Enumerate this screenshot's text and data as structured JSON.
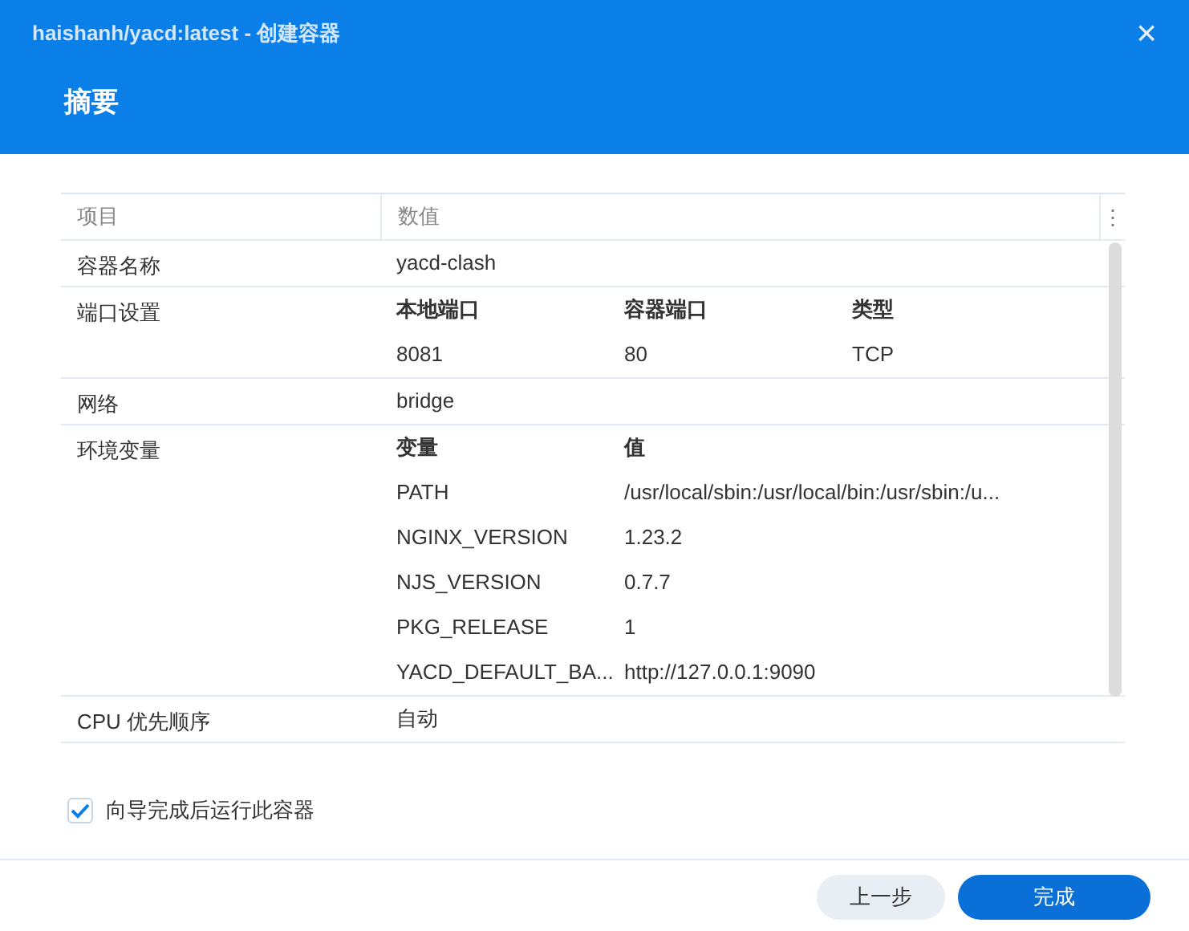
{
  "window": {
    "title": "haishanh/yacd:latest - 创建容器",
    "close": "×"
  },
  "heading": "摘要",
  "table": {
    "columns": [
      "项目",
      "数值"
    ],
    "menu": "⋮",
    "rows": [
      {
        "label": "容器名称",
        "kind": "text",
        "value": "yacd-clash"
      },
      {
        "label": "端口设置",
        "kind": "grid",
        "headers": [
          "本地端口",
          "容器端口",
          "类型"
        ],
        "rows": [
          [
            "8081",
            "80",
            "TCP"
          ]
        ]
      },
      {
        "label": "网络",
        "kind": "text",
        "value": "bridge"
      },
      {
        "label": "环境变量",
        "kind": "grid",
        "headers": [
          "变量",
          "值"
        ],
        "rows": [
          [
            "PATH",
            "/usr/local/sbin:/usr/local/bin:/usr/sbin:/u..."
          ],
          [
            "NGINX_VERSION",
            "1.23.2"
          ],
          [
            "NJS_VERSION",
            "0.7.7"
          ],
          [
            "PKG_RELEASE",
            "1"
          ],
          [
            "YACD_DEFAULT_BA...",
            "http://127.0.0.1:9090"
          ]
        ]
      },
      {
        "label": "CPU 优先顺序",
        "kind": "text",
        "value": "自动"
      }
    ]
  },
  "run_after": {
    "label": "向导完成后运行此容器",
    "checked": true
  },
  "buttons": [
    {
      "label": "上一步",
      "kind": "secondary"
    },
    {
      "label": "完成",
      "kind": "primary"
    }
  ]
}
